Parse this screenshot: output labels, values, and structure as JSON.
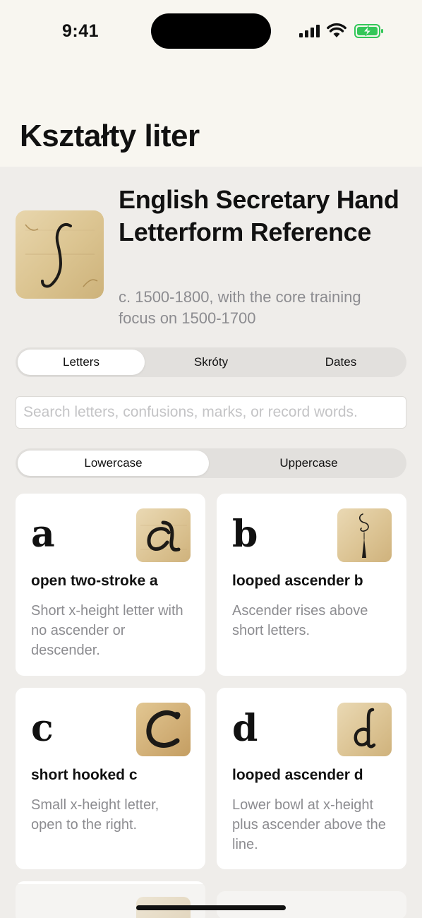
{
  "status_bar": {
    "time": "9:41"
  },
  "page_title": "Kształty liter",
  "hero": {
    "title": "English Secretary Hand Letterform Reference",
    "subtitle": "c. 1500-1800, with the core training focus on 1500-1700"
  },
  "tabs": [
    {
      "label": "Letters",
      "active": true
    },
    {
      "label": "Skróty",
      "active": false
    },
    {
      "label": "Dates",
      "active": false
    }
  ],
  "search": {
    "placeholder": "Search letters, confusions, marks, or record words.",
    "value": ""
  },
  "case_toggle": [
    {
      "label": "Lowercase",
      "active": true
    },
    {
      "label": "Uppercase",
      "active": false
    }
  ],
  "letters": [
    {
      "glyph": "a",
      "name": "open two-stroke a",
      "description": "Short x-height letter with no ascender or descender."
    },
    {
      "glyph": "b",
      "name": "looped ascender b",
      "description": "Ascender rises above short letters."
    },
    {
      "glyph": "c",
      "name": "short hooked c",
      "description": "Small x-height letter, open to the right."
    },
    {
      "glyph": "d",
      "name": "looped ascender d",
      "description": "Lower bowl at x-height plus ascender above the line."
    }
  ],
  "colors": {
    "background": "#efedea",
    "header_background": "#f8f6f0",
    "secondary_text": "#8c8c90",
    "parchment": "#dcc592",
    "battery_green": "#34c759"
  }
}
